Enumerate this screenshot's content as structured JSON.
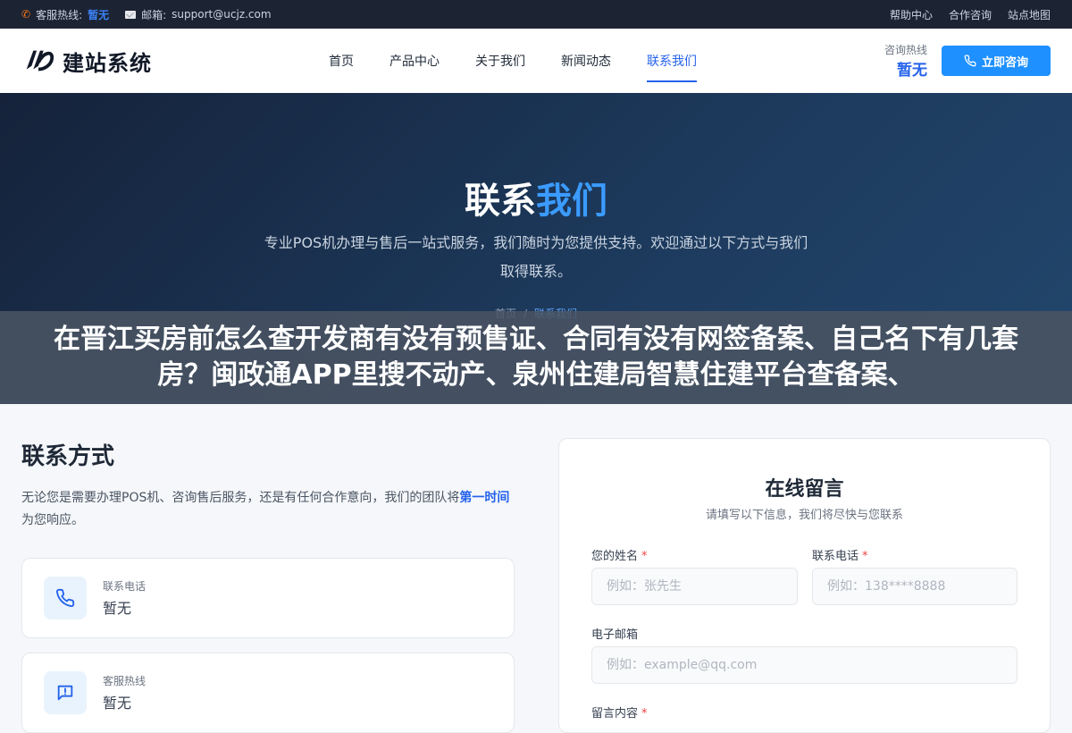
{
  "topbar": {
    "service_label": "客服热线:",
    "service_value": "暂无",
    "email_label": "邮箱:",
    "email_value": "support@ucjz.com",
    "links": [
      "帮助中心",
      "合作咨询",
      "站点地图"
    ]
  },
  "header": {
    "logo_text": "建站系统",
    "nav": [
      "首页",
      "产品中心",
      "关于我们",
      "新闻动态",
      "联系我们"
    ],
    "active_nav": "联系我们",
    "hotline_label": "咨询热线",
    "hotline_value": "暂无",
    "cta_label": "立即咨询"
  },
  "hero": {
    "title_main": "联系",
    "title_accent": "我们",
    "subtitle": "专业POS机办理与售后一站式服务，我们随时为您提供支持。欢迎通过以下方式与我们取得联系。",
    "breadcrumb_home": "首页",
    "breadcrumb_sep": "/",
    "breadcrumb_current": "联系我们"
  },
  "overlay": {
    "text": "在晋江买房前怎么查开发商有没有预售证、合同有没有网签备案、自己名下有几套房？闽政通APP里搜不动产、泉州住建局智慧住建平台查备案、"
  },
  "contact": {
    "title": "联系方式",
    "desc_before": "无论您是需要办理POS机、咨询售后服务，还是有任何合作意向，我们的团队将",
    "desc_highlight": "第一时间",
    "desc_after": "为您响应。",
    "cards": [
      {
        "label": "联系电话",
        "value": "暂无"
      },
      {
        "label": "客服热线",
        "value": "暂无"
      }
    ]
  },
  "form": {
    "title": "在线留言",
    "subtitle": "请填写以下信息，我们将尽快与您联系",
    "name_label": "您的姓名",
    "name_placeholder": "例如：张先生",
    "phone_label": "联系电话",
    "phone_placeholder": "例如：138****8888",
    "email_label": "电子邮箱",
    "email_placeholder": "例如：example@qq.com",
    "message_label": "留言内容",
    "required_mark": "*"
  },
  "colors": {
    "accent": "#2563eb",
    "cta": "#1e90ff",
    "topbar_bg": "#1c2434",
    "hero_bg": "#1d3b5e"
  }
}
